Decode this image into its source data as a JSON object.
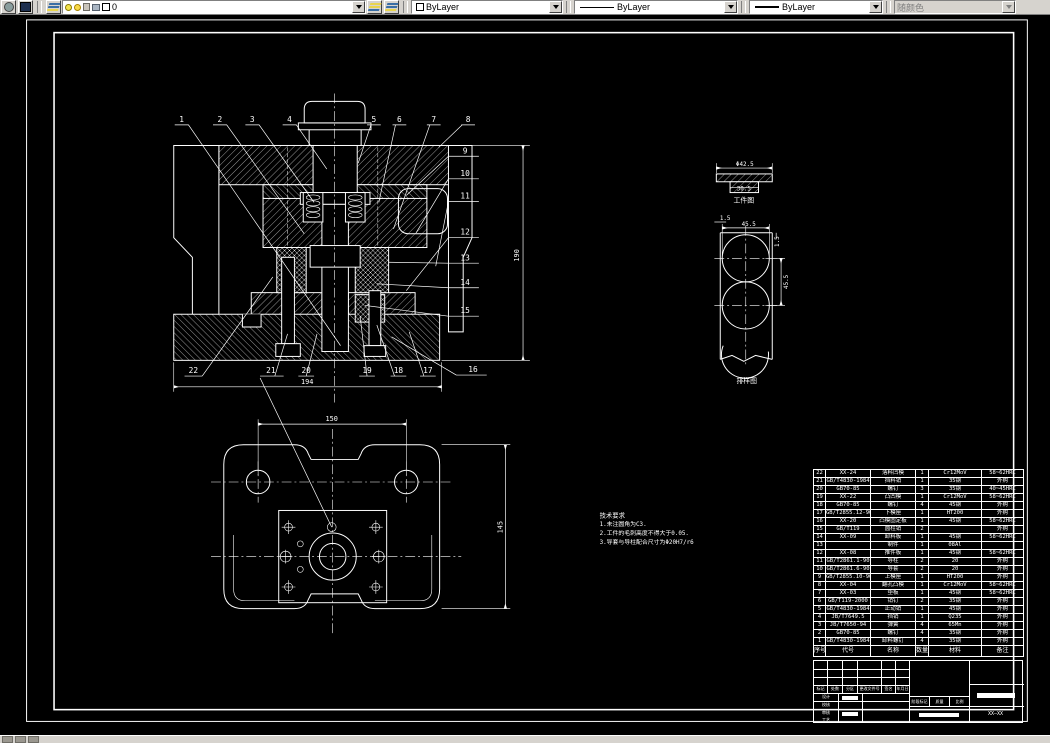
{
  "toolbar": {
    "layer": {
      "name": "0"
    },
    "color": {
      "value": "ByLayer"
    },
    "linetype": {
      "value": "ByLayer"
    },
    "lineweight": {
      "value": "ByLayer"
    },
    "plot_style": {
      "value": "随颜色"
    }
  },
  "drawing": {
    "callouts": [
      "1",
      "2",
      "3",
      "4",
      "5",
      "6",
      "7",
      "8",
      "9",
      "10",
      "11",
      "12",
      "13",
      "14",
      "15",
      "16",
      "17",
      "18",
      "19",
      "20",
      "21",
      "22"
    ],
    "dims": {
      "section_height": "190",
      "section_width": "194",
      "plan_width": "150",
      "plan_height": "145",
      "wp_dia": "Φ42.5",
      "wp_inner": "30.5",
      "strip_margin_top": "1.5",
      "strip_width": "45.5",
      "strip_margin_side": "1.5",
      "strip_pitch": "45.5"
    },
    "views": {
      "workpiece": "工件图",
      "strip": "排样图"
    },
    "tech": {
      "title": "技术要求",
      "line1": "1.未注圆角为C3.",
      "line2": "2.工件的毛刺高度不得大于0.05.",
      "line3": "3.导套与导柱配合尺寸为Φ20H7/r6"
    }
  },
  "bom": {
    "headers": [
      "序号",
      "代号",
      "名称",
      "数量",
      "材料",
      "备注"
    ],
    "rows": [
      {
        "no": "22",
        "code": "XX-24",
        "name": "落料凹模",
        "qty": "1",
        "mat": "Cr12MoV",
        "note": "58~62HRC"
      },
      {
        "no": "21",
        "code": "GB/T4830-1984",
        "name": "挡料销",
        "qty": "1",
        "mat": "35钢",
        "note": "外购"
      },
      {
        "no": "20",
        "code": "GB70-85",
        "name": "螺钉",
        "qty": "3",
        "mat": "35钢",
        "note": "40~45HRC"
      },
      {
        "no": "19",
        "code": "XX-22",
        "name": "凸凹模",
        "qty": "1",
        "mat": "Cr12MoV",
        "note": "58~62HRC"
      },
      {
        "no": "18",
        "code": "GB70-85",
        "name": "螺钉",
        "qty": "4",
        "mat": "45钢",
        "note": "外购"
      },
      {
        "no": "17",
        "code": "GB/T2855.12-90",
        "name": "下模座",
        "qty": "1",
        "mat": "HT200",
        "note": "外购"
      },
      {
        "no": "16",
        "code": "XX-20",
        "name": "凸模固定板",
        "qty": "1",
        "mat": "45钢",
        "note": "58~62HRC"
      },
      {
        "no": "15",
        "code": "GB/T119",
        "name": "圆柱销",
        "qty": "2",
        "mat": "",
        "note": "外购"
      },
      {
        "no": "14",
        "code": "XX-09",
        "name": "卸料板",
        "qty": "1",
        "mat": "45钢",
        "note": "58~62HRC"
      },
      {
        "no": "13",
        "code": "",
        "name": "制件",
        "qty": "1",
        "mat": "08Al",
        "note": ""
      },
      {
        "no": "12",
        "code": "XX-08",
        "name": "推件板",
        "qty": "1",
        "mat": "45钢",
        "note": "58~62HRC"
      },
      {
        "no": "11",
        "code": "GB/T2861.1-90",
        "name": "导柱",
        "qty": "2",
        "mat": "20",
        "note": "外购"
      },
      {
        "no": "10",
        "code": "GB/T2861.6-90",
        "name": "导套",
        "qty": "2",
        "mat": "20",
        "note": "外购"
      },
      {
        "no": "9",
        "code": "GB/T2855.10-90",
        "name": "上模座",
        "qty": "1",
        "mat": "HT200",
        "note": "外购"
      },
      {
        "no": "8",
        "code": "XX-04",
        "name": "翻孔凸模",
        "qty": "1",
        "mat": "Cr12MoV",
        "note": "58~62HRC"
      },
      {
        "no": "7",
        "code": "XX-03",
        "name": "垫板",
        "qty": "1",
        "mat": "45钢",
        "note": "58~62HRC"
      },
      {
        "no": "6",
        "code": "GB/T119-2000",
        "name": "销钉",
        "qty": "2",
        "mat": "35钢",
        "note": "外购"
      },
      {
        "no": "5",
        "code": "GB/T4830-1984",
        "name": "止动销",
        "qty": "1",
        "mat": "45钢",
        "note": "外购"
      },
      {
        "no": "4",
        "code": "JB/T7649.5",
        "name": "挡销",
        "qty": "1",
        "mat": "Q235",
        "note": "外购"
      },
      {
        "no": "3",
        "code": "JB/T7650-94",
        "name": "弹簧",
        "qty": "4",
        "mat": "65Mn",
        "note": "外购"
      },
      {
        "no": "2",
        "code": "GB70-85",
        "name": "螺钉",
        "qty": "4",
        "mat": "35钢",
        "note": "外购"
      },
      {
        "no": "1",
        "code": "GB/T4830-1984",
        "name": "卸料螺钉",
        "qty": "4",
        "mat": "35钢",
        "note": "外购"
      }
    ]
  },
  "title_block": {
    "col_labels": [
      "标记",
      "处数",
      "分区",
      "更改文件号",
      "签名",
      "年月日"
    ],
    "row_labels": [
      "设计",
      "校核",
      "审核",
      "工艺"
    ],
    "mid_labels": [
      "阶段标记",
      "质量",
      "比例"
    ],
    "drawing_no": "XX—XX"
  }
}
